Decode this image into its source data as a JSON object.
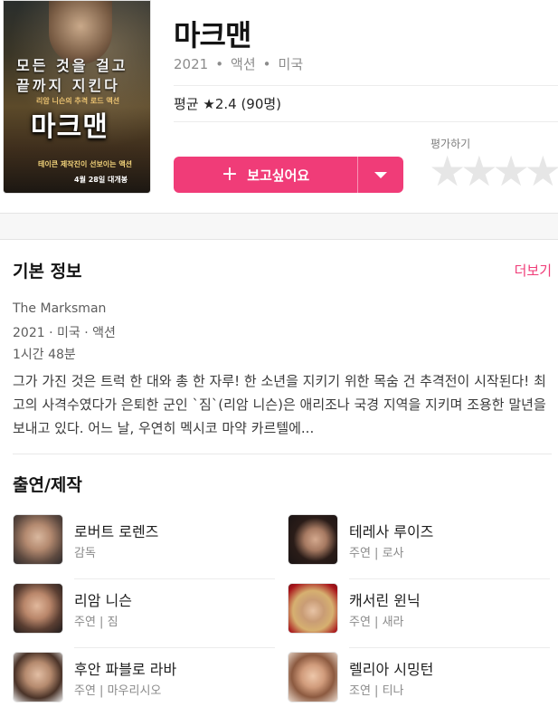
{
  "poster": {
    "tag_line1": "모든 것을 걸고",
    "tag_line2": "끝까지 지킨다",
    "sub": "리암 니슨의 추격 로드 액션",
    "title": "마크맨",
    "tag": "테이큰 제작진이 선보이는 액션",
    "date": "4월 28일 대개봉"
  },
  "movie": {
    "title": "마크맨",
    "year": "2021",
    "genre": "액션",
    "country": "미국",
    "rating_text": "평균 ★2.4 (90명)"
  },
  "actions": {
    "want_label": "보고싶어요",
    "rate_label": "평가하기",
    "star_count": 4
  },
  "info": {
    "section_title": "기본 정보",
    "more_label": "더보기",
    "original_title": "The Marksman",
    "year_country_genre": "2021 · 미국 · 액션",
    "runtime": "1시간 48분",
    "synopsis": "그가 가진 것은 트럭 한 대와 총 한 자루! 한 소년을 지키기 위한 목숨 건 추격전이 시작된다! 최고의 사격수였다가 은퇴한 군인 `짐`(리암 니슨)은 애리조나 국경 지역을 지키며 조용한 말년을 보내고 있다. 어느 날, 우연히 멕시코 마약 카르텔에..."
  },
  "cast": {
    "section_title": "출연/제작",
    "people": [
      {
        "name": "로버트 로렌즈",
        "role": "감독"
      },
      {
        "name": "테레사 루이즈",
        "role": "주연 | 로사"
      },
      {
        "name": "리암 니슨",
        "role": "주연 | 짐"
      },
      {
        "name": "캐서린 윈닉",
        "role": "주연 | 새라"
      },
      {
        "name": "후안 파블로 라바",
        "role": "주연 | 마우리시오"
      },
      {
        "name": "렐리아 시밍턴",
        "role": "조연 | 티나"
      }
    ]
  }
}
